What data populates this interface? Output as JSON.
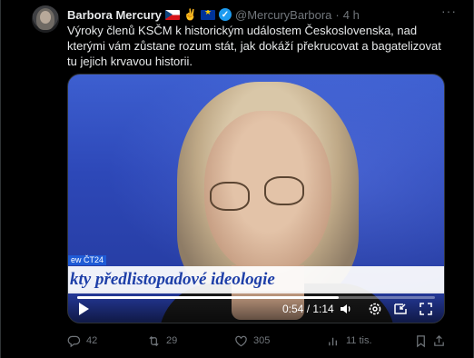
{
  "author": {
    "name": "Barbora Mercury",
    "handle": "@MercuryBarbora",
    "separator": "·",
    "time": "4 h",
    "flag_icons": [
      "czech-flag-icon",
      "victory-hand-icon",
      "eu-flag-icon"
    ],
    "verified_icon": "verified-badge-icon"
  },
  "more_icon": "more-options-icon",
  "more_label": "···",
  "tweet_text": "Výroky členů KSČM k historickým událostem Československa, nad kterými vám zůstane rozum stát, jak dokáží překrucovat a bagatelizovat tu jejich krvavou historii.",
  "video": {
    "channel_label": "ew ČT24",
    "ticker_text": "kty předlistopadové ideologie",
    "elapsed": "0:54",
    "duration": "1:14",
    "progress": 0.73,
    "time_readout": "0:54 / 1:14"
  },
  "actions": {
    "reply_count": "42",
    "retweet_count": "29",
    "like_count": "305",
    "views_count": "11 tis."
  },
  "colors": {
    "background": "#000000",
    "text": "#e7e9ea",
    "muted": "#71767b",
    "verified": "#1d9bf0",
    "ticker_blue": "#1e3fa8"
  }
}
